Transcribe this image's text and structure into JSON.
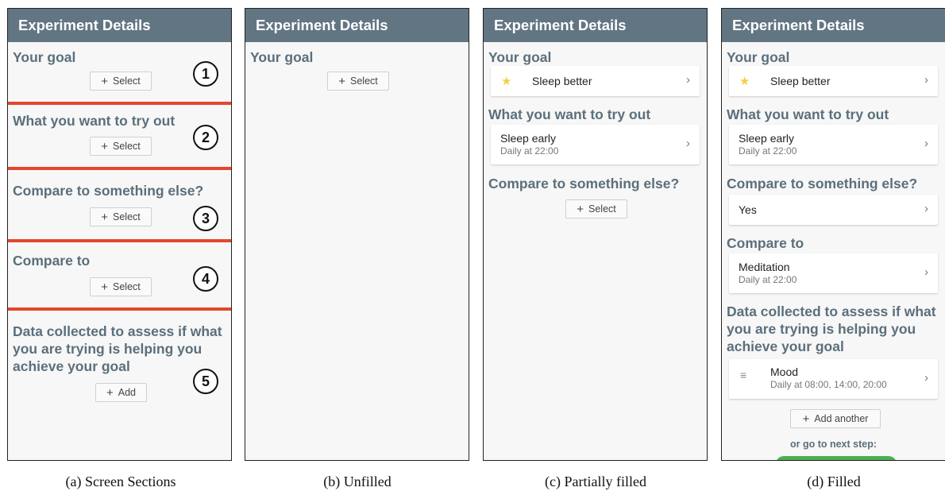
{
  "header_title": "Experiment Details",
  "panel_a": {
    "sections": [
      "Your goal",
      "What you want to try out",
      "Compare to something else?",
      "Compare to",
      "Data collected to assess if what you are trying is helping you achieve your goal"
    ],
    "numbers": [
      "1",
      "2",
      "3",
      "4",
      "5"
    ],
    "select_label": "Select",
    "add_label": "Add"
  },
  "panel_b": {
    "section": "Your goal",
    "select_label": "Select"
  },
  "panel_c": {
    "goal_title": "Your goal",
    "goal_value": "Sleep better",
    "try_title": "What you want to try out",
    "try_value": "Sleep early",
    "try_sub": "Daily at 22:00",
    "compare_title": "Compare to something else?",
    "select_label": "Select"
  },
  "panel_d": {
    "goal_title": "Your goal",
    "goal_value": "Sleep better",
    "try_title": "What you want to try out",
    "try_value": "Sleep early",
    "try_sub": "Daily at 22:00",
    "compare_q_title": "Compare to something else?",
    "compare_q_value": "Yes",
    "compare_to_title": "Compare to",
    "compare_to_value": "Meditation",
    "compare_to_sub": "Daily at 22:00",
    "data_title": "Data collected to assess if what you are trying is helping you achieve your goal",
    "data_value": "Mood",
    "data_sub": "Daily at 08:00, 14:00, 20:00",
    "add_another_label": "Add another",
    "next_step_text": "or go to next step:"
  },
  "captions": [
    "(a) Screen Sections",
    "(b) Unfilled",
    "(c) Partially filled",
    "(d) Filled"
  ],
  "icons": {
    "plus": "+",
    "chevron": "›",
    "star": "★",
    "list": "≡"
  },
  "colors": {
    "header_bg": "#627582",
    "section_title": "#5b6f7c",
    "divider_red": "#e4472c",
    "star_yellow": "#f4d03f",
    "next_green": "#4caf50"
  }
}
